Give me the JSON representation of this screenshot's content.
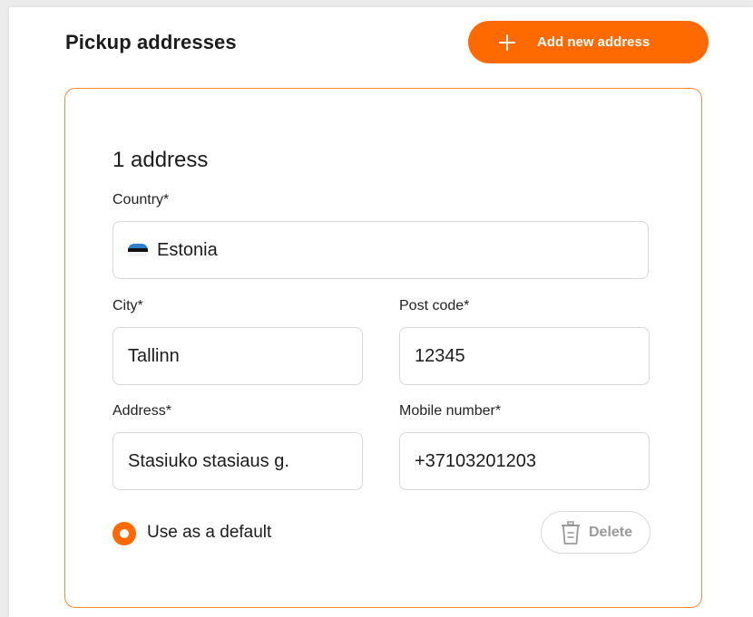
{
  "header": {
    "title": "Pickup addresses",
    "add_button_label": "Add new address"
  },
  "address_card": {
    "heading": "1 address",
    "country": {
      "label": "Country*",
      "value": "Estonia",
      "flag_icon": "estonia-flag-icon"
    },
    "city": {
      "label": "City*",
      "value": "Tallinn"
    },
    "post_code": {
      "label": "Post code*",
      "value": "12345"
    },
    "address": {
      "label": "Address*",
      "value": "Stasiuko stasiaus g."
    },
    "mobile": {
      "label": "Mobile number*",
      "value": "+37103201203"
    },
    "default_option": {
      "label": "Use as a default",
      "selected": true
    },
    "delete_label": "Delete"
  },
  "colors": {
    "accent": "#ff6a00",
    "card_border": "#ff8a33",
    "field_border": "#d8d8d8",
    "muted_text": "#9a9a9a"
  },
  "icons": [
    "plus-icon",
    "estonia-flag-icon",
    "radio-selected-icon",
    "trash-icon"
  ]
}
